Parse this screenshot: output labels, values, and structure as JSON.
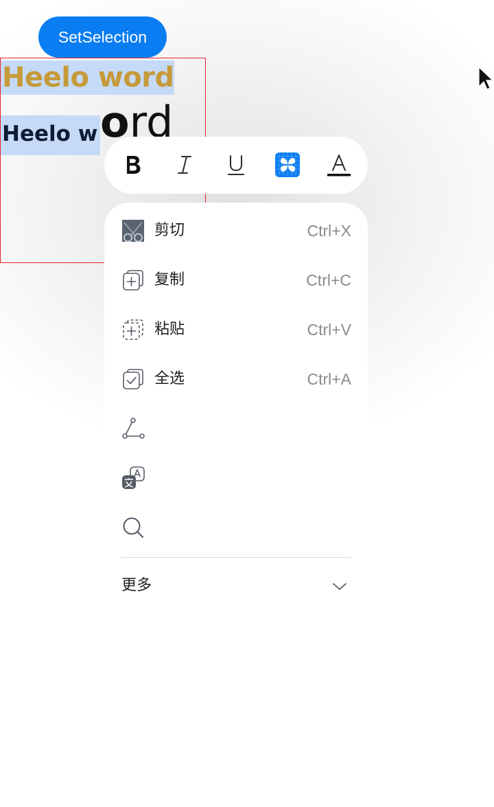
{
  "header": {
    "set_selection_label": "SetSelection"
  },
  "editor": {
    "line1_text": "Heelo word",
    "line2_small_text": "Heelo w",
    "line2_big_bold": "o",
    "line2_big_rest": "rd",
    "colors": {
      "line1": "#c69a3a",
      "line2": "#0e1b35",
      "selection": "#c5daf6",
      "border": "#e8202a"
    }
  },
  "toolbar": {
    "items": [
      {
        "name": "bold",
        "icon": "bold-icon",
        "glyph": "B"
      },
      {
        "name": "italic",
        "icon": "italic-icon",
        "glyph": "I"
      },
      {
        "name": "underline",
        "icon": "underline-icon",
        "glyph": "U"
      },
      {
        "name": "apps",
        "icon": "apps-grid-icon",
        "active": true
      },
      {
        "name": "font-color",
        "icon": "font-color-icon",
        "glyph": "A"
      }
    ],
    "accent": "#0a7df2"
  },
  "menu": {
    "items": [
      {
        "icon": "scissors-icon",
        "label": "剪切",
        "shortcut": "Ctrl+X"
      },
      {
        "icon": "copy-icon",
        "label": "复制",
        "shortcut": "Ctrl+C"
      },
      {
        "icon": "paste-icon",
        "label": "粘贴",
        "shortcut": "Ctrl+V"
      },
      {
        "icon": "select-all-icon",
        "label": "全选",
        "shortcut": "Ctrl+A"
      },
      {
        "icon": "share-icon",
        "label": "",
        "shortcut": ""
      },
      {
        "icon": "translate-icon",
        "label": "",
        "shortcut": ""
      },
      {
        "icon": "search-icon",
        "label": "",
        "shortcut": ""
      }
    ],
    "more_label": "更多"
  }
}
